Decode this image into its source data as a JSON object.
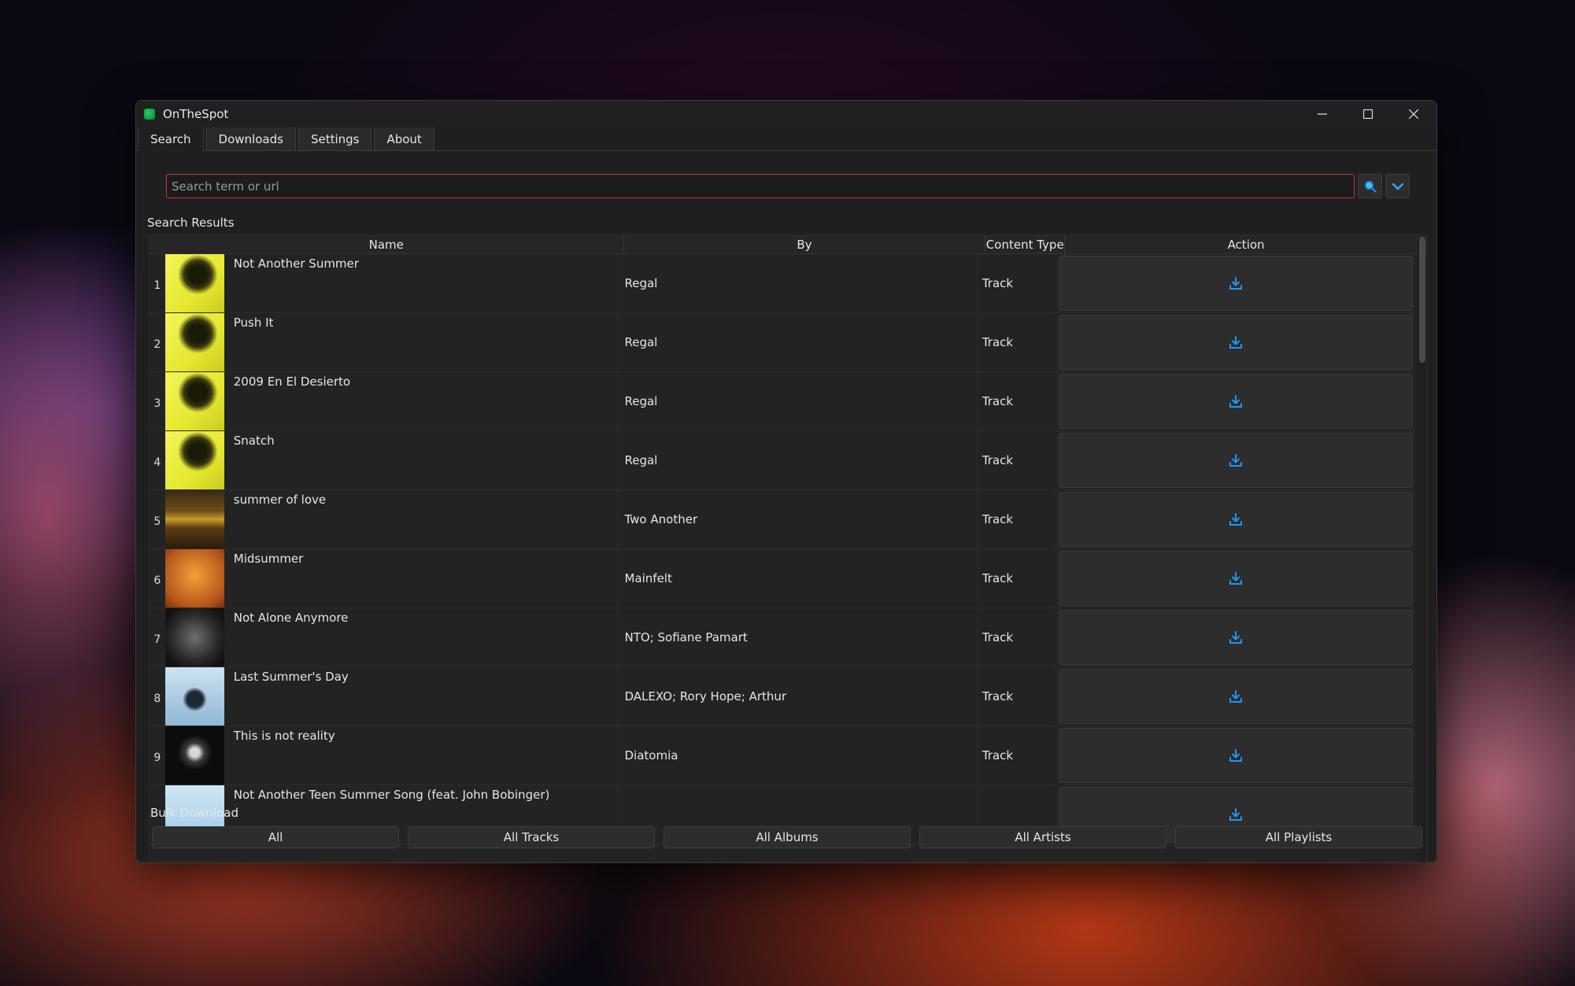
{
  "window": {
    "title": "OnTheSpot"
  },
  "tabs": [
    {
      "label": "Search",
      "active": true
    },
    {
      "label": "Downloads"
    },
    {
      "label": "Settings"
    },
    {
      "label": "About"
    }
  ],
  "search": {
    "placeholder": "Search term or url",
    "value": ""
  },
  "results_label": "Search Results",
  "table": {
    "headers": {
      "name": "Name",
      "by": "By",
      "content_type": "Content Type",
      "action": "Action"
    },
    "rows": [
      {
        "num": "1",
        "name": "Not Another Summer",
        "by": "Regal",
        "type": "Track",
        "art": "yellow"
      },
      {
        "num": "2",
        "name": "Push It",
        "by": "Regal",
        "type": "Track",
        "art": "yellow"
      },
      {
        "num": "3",
        "name": "2009 En El Desierto",
        "by": "Regal",
        "type": "Track",
        "art": "yellow"
      },
      {
        "num": "4",
        "name": "Snatch",
        "by": "Regal",
        "type": "Track",
        "art": "yellow"
      },
      {
        "num": "5",
        "name": "summer of love",
        "by": "Two Another",
        "type": "Track",
        "art": "gold-dark"
      },
      {
        "num": "6",
        "name": "Midsummer",
        "by": "Mainfelt",
        "type": "Track",
        "art": "orange"
      },
      {
        "num": "7",
        "name": "Not Alone Anymore",
        "by": "NTO; Sofiane Pamart",
        "type": "Track",
        "art": "dark"
      },
      {
        "num": "8",
        "name": "Last Summer's Day",
        "by": "DALEXO; Rory Hope; Arthur",
        "type": "Track",
        "art": "lightblue"
      },
      {
        "num": "9",
        "name": "This is not reality",
        "by": "Diatomia",
        "type": "Track",
        "art": "black"
      },
      {
        "num": "",
        "name": "Not Another Teen Summer Song (feat. John Bobinger)",
        "by": "",
        "type": "",
        "art": "sky"
      }
    ]
  },
  "bulk": {
    "label": "Bulk Download",
    "buttons": [
      "All",
      "All Tracks",
      "All Albums",
      "All Artists",
      "All Playlists"
    ]
  },
  "colors": {
    "accent": "#2196f3",
    "search_border": "#c0392b"
  },
  "icons": {
    "download": "download-icon",
    "search": "search-icon",
    "dropdown": "chevron-down-icon"
  }
}
